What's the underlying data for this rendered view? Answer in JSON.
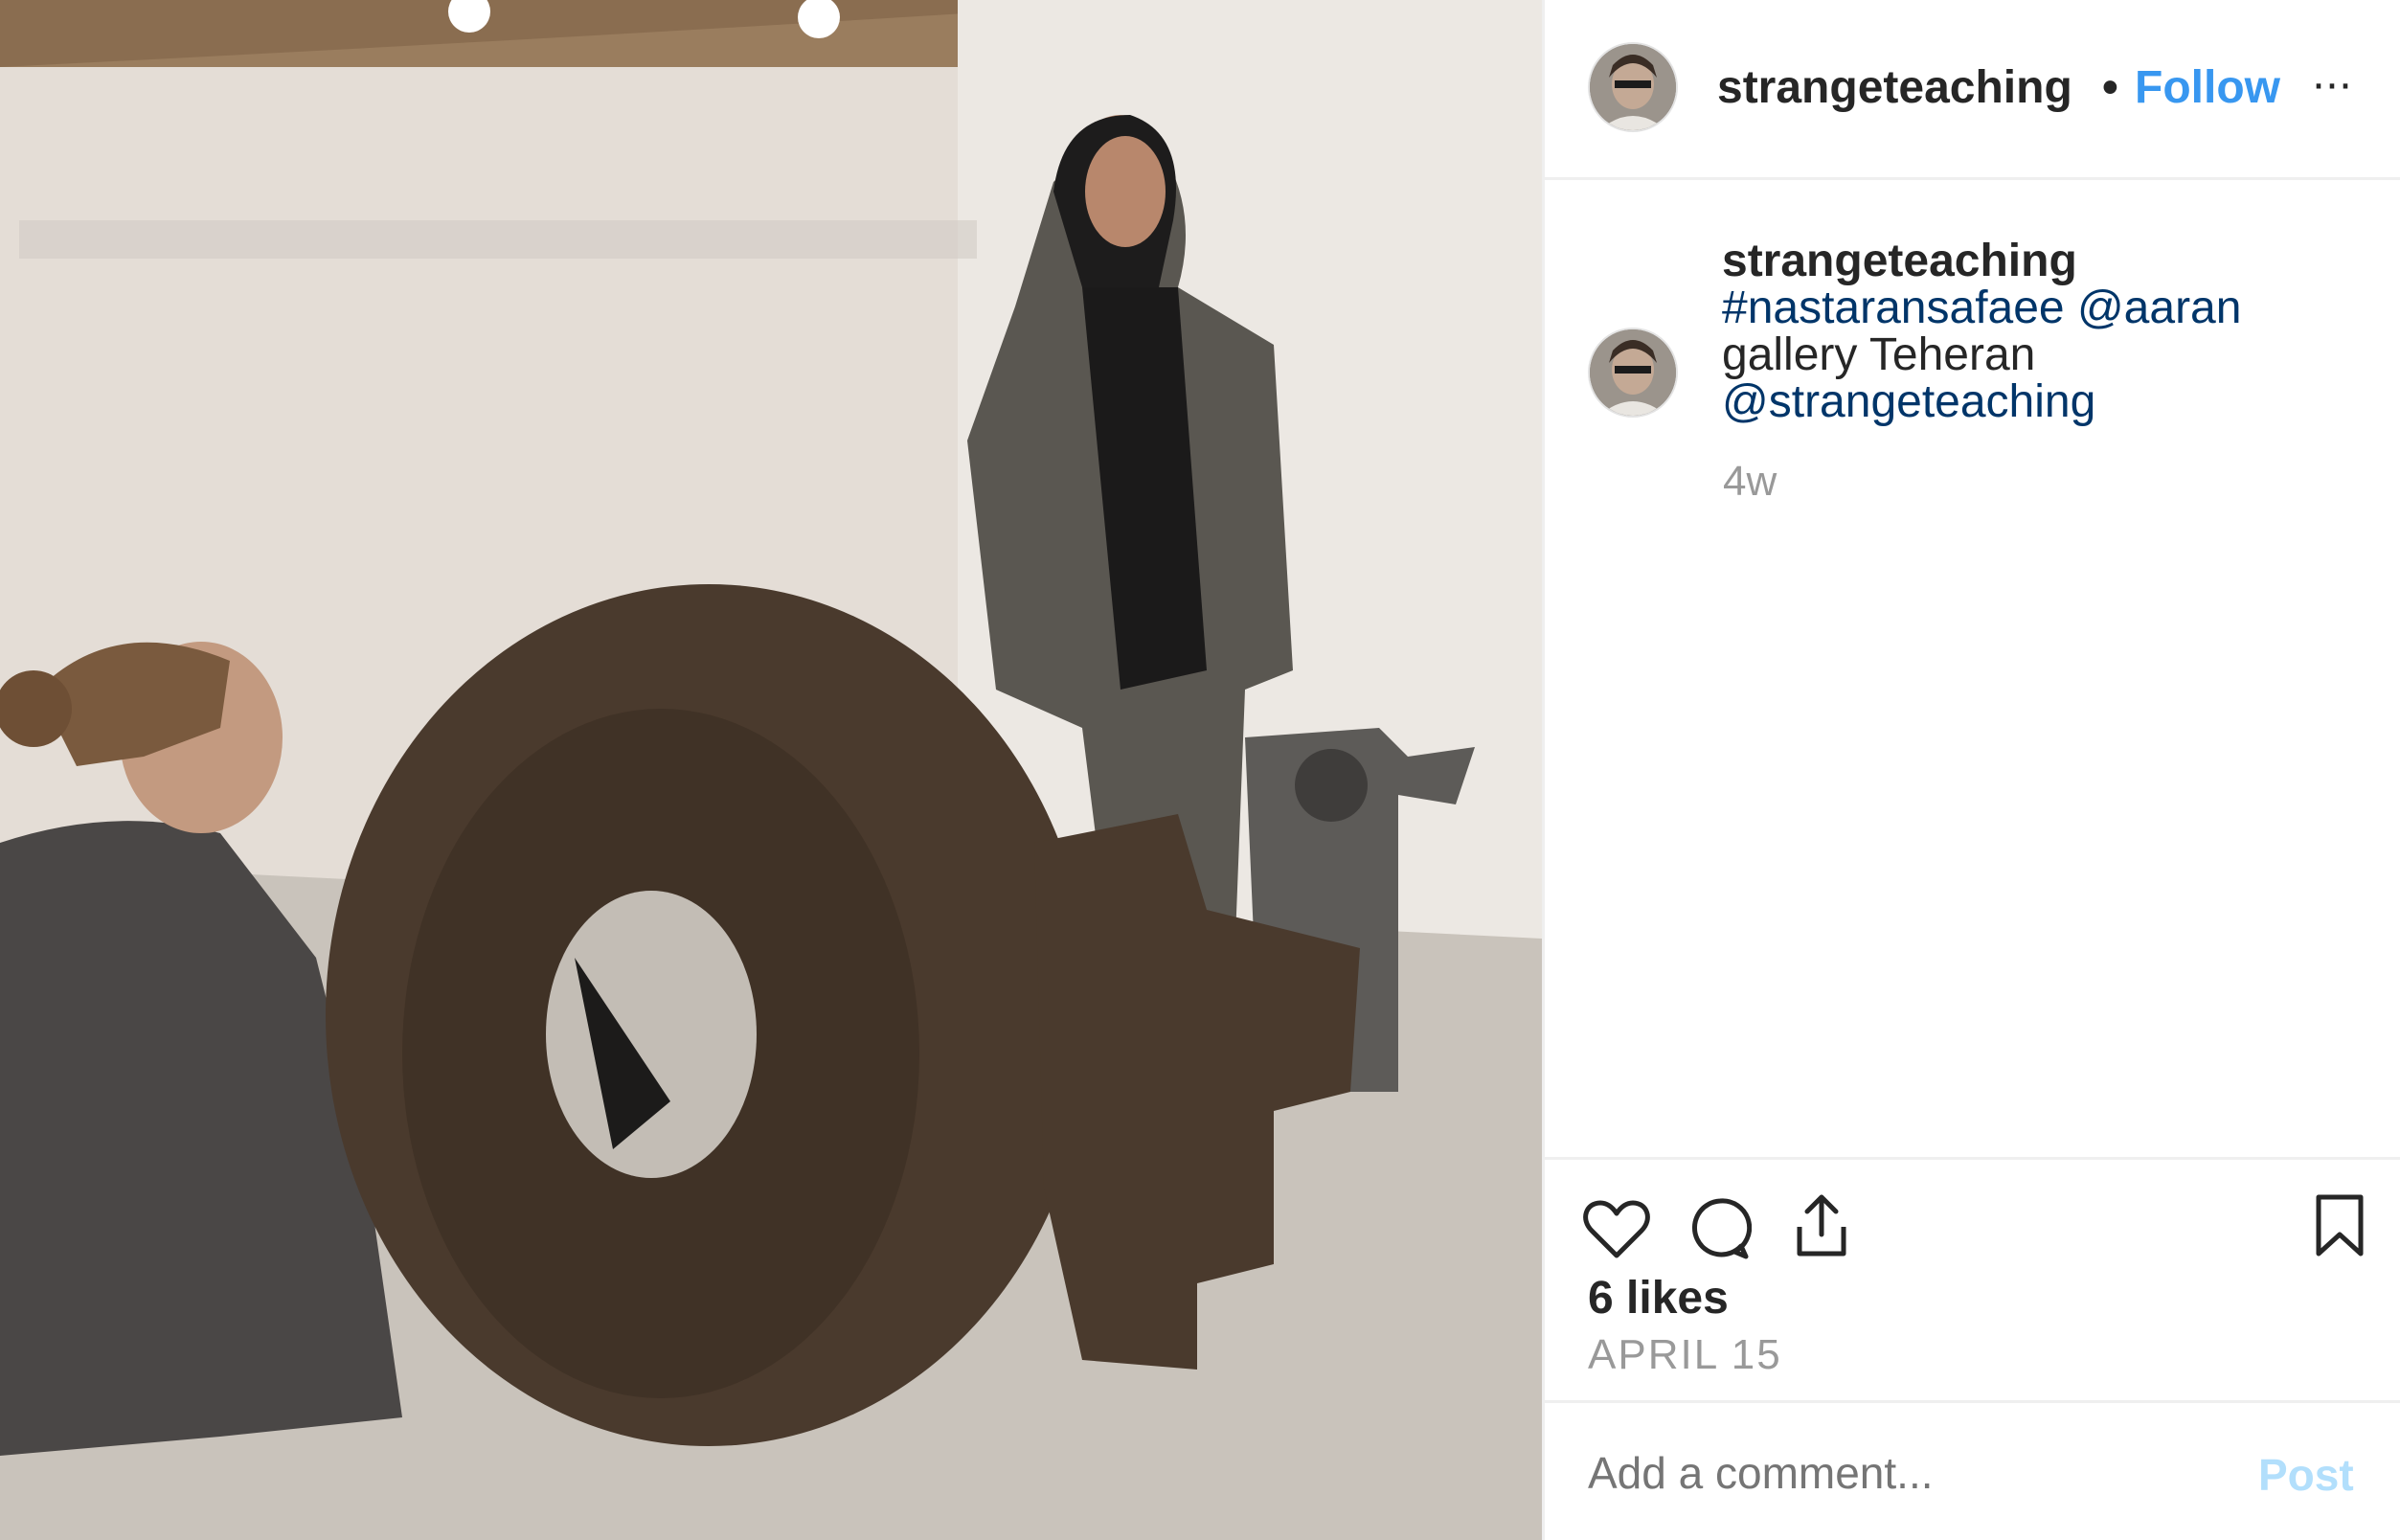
{
  "post": {
    "username": "strangeteaching",
    "separator": "•",
    "follow_label": "Follow",
    "more_label": "···",
    "caption": {
      "username": "strangeteaching",
      "tag1": "#nastaransafaee",
      "tag2": "@aaran",
      "text": "gallery Teheran",
      "tag3": "@strangeteaching"
    },
    "time_ago": "4w",
    "likes": "6 likes",
    "date": "APRIL 15",
    "comment_placeholder": "Add a comment...",
    "post_label": "Post"
  },
  "colors": {
    "link": "#3897f0",
    "hashtag": "#003569",
    "muted": "#999999",
    "post_disabled": "#b2dffc",
    "text": "#262626"
  },
  "icons": [
    "heart-icon",
    "comment-icon",
    "share-icon",
    "bookmark-icon",
    "more-options-icon"
  ]
}
